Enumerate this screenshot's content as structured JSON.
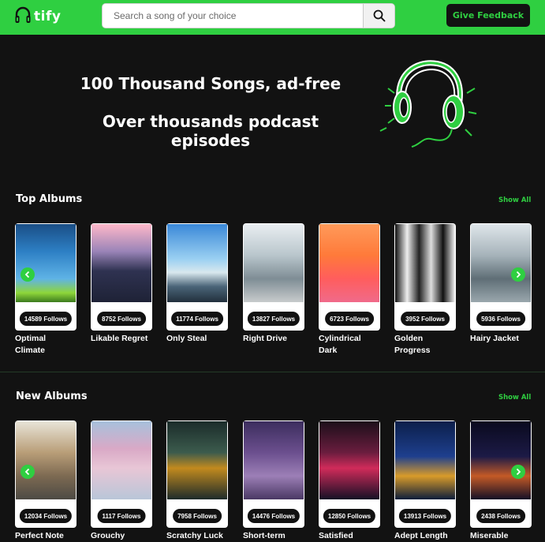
{
  "navbar": {
    "brand": "tify",
    "search_placeholder": "Search a song of your choice",
    "feedback_label": "Give Feedback"
  },
  "hero": {
    "line1": "100 Thousand Songs, ad-free",
    "line2": "Over thousands podcast episodes"
  },
  "sections": [
    {
      "title": "Top Albums",
      "show_all": "Show All",
      "albums": [
        {
          "name": "Optimal Climate",
          "follows": "14589 Follows"
        },
        {
          "name": "Likable Regret",
          "follows": "8752 Follows"
        },
        {
          "name": "Only Steal",
          "follows": "11774 Follows"
        },
        {
          "name": "Right Drive",
          "follows": "13827 Follows"
        },
        {
          "name": "Cylindrical Dark",
          "follows": "6723 Follows"
        },
        {
          "name": "Golden Progress",
          "follows": "3952 Follows"
        },
        {
          "name": "Hairy Jacket",
          "follows": "5936 Follows"
        }
      ]
    },
    {
      "title": "New Albums",
      "show_all": "Show All",
      "albums": [
        {
          "name": "Perfect Note",
          "follows": "12034 Follows"
        },
        {
          "name": "Grouchy Queen",
          "follows": "1117 Follows"
        },
        {
          "name": "Scratchy Luck",
          "follows": "7958 Follows"
        },
        {
          "name": "Short-term",
          "follows": "14476 Follows"
        },
        {
          "name": "Satisfied",
          "follows": "12850 Follows"
        },
        {
          "name": "Adept Length",
          "follows": "13913 Follows"
        },
        {
          "name": "Miserable",
          "follows": "2438 Follows"
        }
      ]
    }
  ],
  "colors": {
    "accent": "#2fcf41",
    "background": "#121212"
  },
  "icons": {
    "logo": "headphones-icon",
    "search": "search-icon",
    "prev": "chevron-left-icon",
    "next": "chevron-right-icon"
  }
}
